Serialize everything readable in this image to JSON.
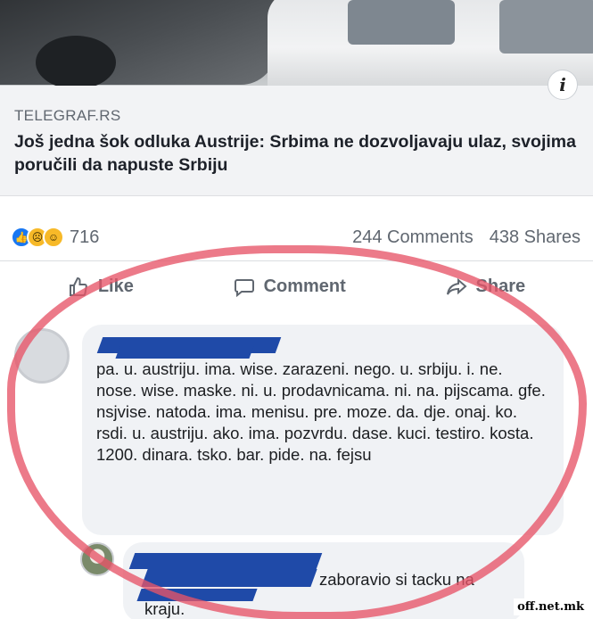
{
  "post": {
    "info_icon_glyph": "i",
    "link": {
      "source": "TELEGRAF.RS",
      "headline": "Još jedna šok odluka Austrije: Srbima ne dozvoljavaju ulaz, svojima poručili da napuste Srbiju"
    },
    "stats": {
      "reactions": [
        "like-icon",
        "sad-icon",
        "haha-icon"
      ],
      "reaction_count": "716",
      "comments": "244 Comments",
      "shares": "438 Shares"
    },
    "actions": {
      "like_label": "Like",
      "comment_label": "Comment",
      "share_label": "Share"
    }
  },
  "comments": [
    {
      "author_redacted": true,
      "text": "pa. u. austriju. ima. wise. zarazeni. nego. u. srbiju. i. ne. nose. wise. maske. ni. u. prodavnicama. ni. na. pijscama. gfe. nsjvise. natoda. ima.  menisu. pre. moze. da. dje. onaj. ko. rsdi. u. austriju. ako. ima. pozvrdu. dase. kuci. testiro. kosta. 1200. dinara. tsko. bar. pide. na. fejsu"
    },
    {
      "author_redacted": true,
      "text_line1": "zaboravio si tacku na",
      "text_line2": "kraju."
    }
  ],
  "annotation": {
    "highlight_color": "#e75468"
  },
  "watermark": "off.net.mk",
  "colors": {
    "link_bg": "#f2f3f5",
    "redaction": "#1f4aa8",
    "like_blue": "#1877f2"
  }
}
